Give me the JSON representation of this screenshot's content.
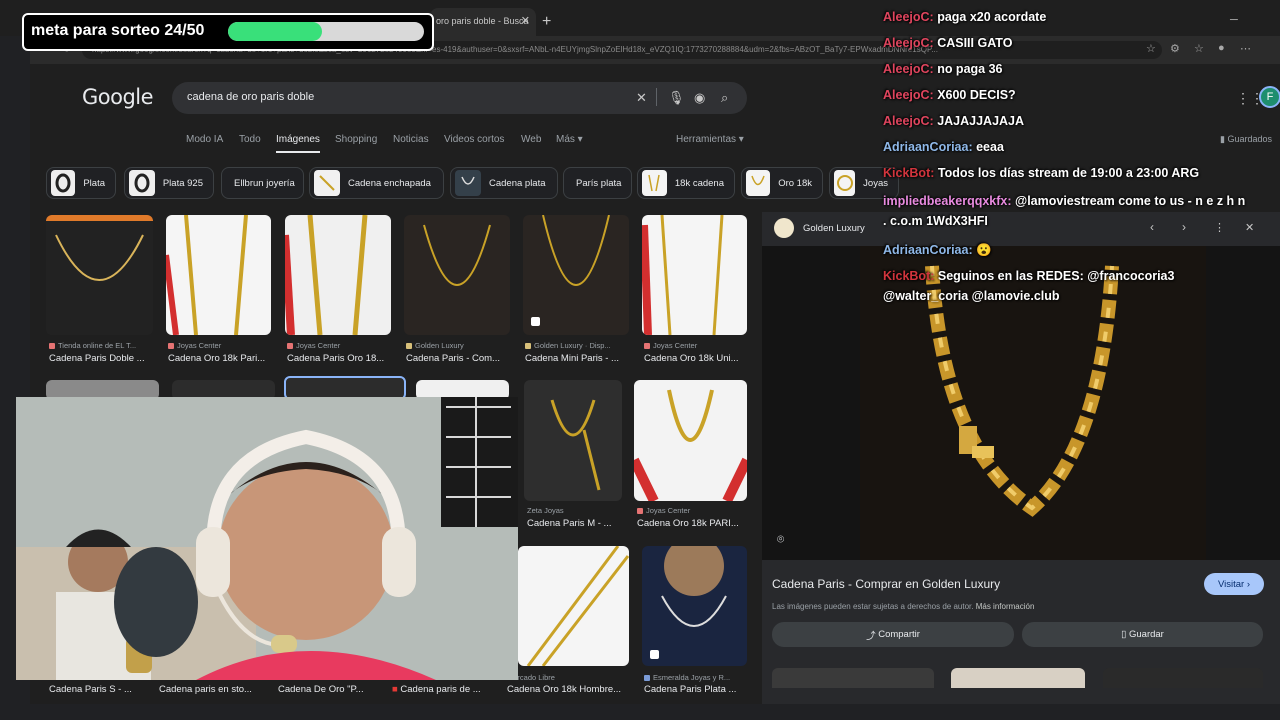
{
  "browser": {
    "tab_title": "oro paris doble - Busca",
    "tab_close": "✕",
    "new_tab": "+",
    "url": "https://www.google.com/search?q=cadena+de+oro+paris+doble&sca_esv=206272e2400e5&hl=es-419&authuser=0&sxsrf=ANbL-n4EUYjmgSlnpZoElHd18x_eVZQ1IQ:1773270288884&udm=2&fbs=ABzOT_BaTy7-EPWxadmDNNre1sQP..."
  },
  "google": {
    "logo": "Google",
    "query": "cadena de oro paris doble",
    "nav": [
      "Modo IA",
      "Todo",
      "Imágenes",
      "Shopping",
      "Noticias",
      "Videos cortos",
      "Web",
      "Más ▾"
    ],
    "tools": "Herramientas ▾",
    "saved": "Guardados",
    "avatar_letter": "F",
    "chips": [
      "Plata",
      "Plata 925",
      "Ellbrun joyería",
      "Cadena enchapada",
      "Cadena plata",
      "París plata",
      "18k cadena",
      "Oro 18k",
      "Joyas"
    ],
    "results_row1": [
      {
        "source": "Tienda online de EL T...",
        "caption": "Cadena Paris Doble ..."
      },
      {
        "source": "Joyas Center",
        "caption": "Cadena Oro 18k Pari..."
      },
      {
        "source": "Joyas Center",
        "caption": "Cadena Paris Oro 18..."
      },
      {
        "source": "Golden Luxury",
        "caption": "Cadena Paris - Com..."
      },
      {
        "source": "Golden Luxury · Disp...",
        "caption": "Cadena Mini Paris - ..."
      },
      {
        "source": "Joyas Center",
        "caption": "Cadena Oro 18k Uni..."
      }
    ],
    "results_row2": [
      {
        "source": "Zeta Joyas",
        "caption": "Cadena Paris M - ..."
      },
      {
        "source": "Joyas Center",
        "caption": "Cadena Oro 18k PARI..."
      }
    ],
    "results_row3": [
      {
        "source": "",
        "caption": "Cadena Paris S - ..."
      },
      {
        "source": "",
        "caption": "Cadena paris en sto..."
      },
      {
        "source": "",
        "caption": "Cadena De Oro \"P..."
      },
      {
        "source": "",
        "caption": "Cadena paris de ..."
      },
      {
        "source": "Mercado Libre",
        "caption": "Cadena Oro 18k Hombre..."
      },
      {
        "source": "Esmeralda Joyas y R...",
        "caption": "Cadena Paris Plata ..."
      }
    ]
  },
  "preview": {
    "site": "Golden Luxury",
    "title": "Cadena Paris - Comprar en Golden Luxury",
    "visit": "Visitar ›",
    "note": "Las imágenes pueden estar sujetas a derechos de autor.",
    "more_info": "Más información",
    "share": "Compartir",
    "save": "Guardar"
  },
  "overlay": {
    "goal_text": "meta para sorteo 24/50",
    "goal_progress": 0.48
  },
  "chat": [
    {
      "user": "AleejoC:",
      "text": "paga x20 acordate",
      "color": "u-red"
    },
    {
      "user": "AleejoC:",
      "text": "CASIII GATO",
      "color": "u-red"
    },
    {
      "user": "AleejoC:",
      "text": "no paga 36",
      "color": "u-red"
    },
    {
      "user": "AleejoC:",
      "text": "X600 DECIS?",
      "color": "u-red"
    },
    {
      "user": "AleejoC:",
      "text": "JAJAJJAJAJA",
      "color": "u-red"
    },
    {
      "user": "AdriaanCoriaa:",
      "text": "eeaa",
      "color": "u-blue"
    },
    {
      "user": "KickBot:",
      "text": "Todos los días stream de 19:00 a 23:00 ARG",
      "color": "u-kick"
    },
    {
      "user": "impliedbeakerqqxkfx:",
      "text": "@lamoviestream come to us - n e z h n",
      "color": "u-pink"
    },
    {
      "user": "",
      "text": ". c.o.m 1WdX3HFI",
      "color": "u-pink"
    },
    {
      "user": "AdriaanCoriaa:",
      "text": "😮",
      "color": "u-blue"
    },
    {
      "user": "KickBot:",
      "text": "Seguinos en las REDES: @francocoria3",
      "color": "u-kick"
    },
    {
      "user": "",
      "text": "@walter_coria @lamovie.club",
      "color": "u-kick"
    }
  ]
}
